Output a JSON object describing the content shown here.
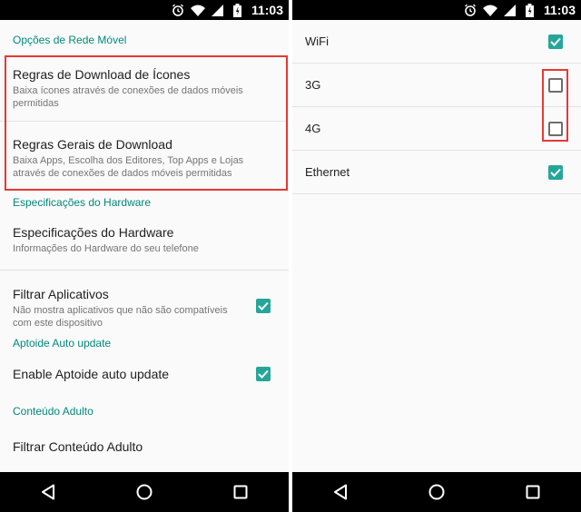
{
  "status": {
    "time": "11:03"
  },
  "left": {
    "sections": [
      {
        "header": "Opções de Rede Móvel"
      },
      {
        "header": "Especificações do Hardware"
      },
      {
        "header": "Aptoide Auto update"
      },
      {
        "header": "Conteúdo Adulto"
      }
    ],
    "items": {
      "download_icons": {
        "title": "Regras de Download de Ícones",
        "summary": "Baixa ícones através de conexões de dados móveis permitidas"
      },
      "download_general": {
        "title": "Regras Gerais de Download",
        "summary": "Baixa Apps, Escolha dos Editores, Top Apps e Lojas através de conexões de dados móveis permitidas"
      },
      "hardware_specs": {
        "title": "Especificações do Hardware",
        "summary": "Informações do Hardware do seu telefone"
      },
      "filter_apps": {
        "title": "Filtrar Aplicativos",
        "summary": "Não mostra aplicativos que não são compatíveis com este dispositivo",
        "checked": true
      },
      "auto_update": {
        "title": "Enable Aptoide auto update",
        "checked": true
      },
      "adult_filter": {
        "title": "Filtrar Conteúdo Adulto"
      }
    }
  },
  "right": {
    "options": [
      {
        "label": "WiFi",
        "checked": true
      },
      {
        "label": "3G",
        "checked": false
      },
      {
        "label": "4G",
        "checked": false
      },
      {
        "label": "Ethernet",
        "checked": true
      }
    ]
  },
  "colors": {
    "accent": "#26a69a",
    "section_header": "#00897b",
    "highlight": "#e53935"
  },
  "icons": [
    "alarm-icon",
    "wifi-icon",
    "signal-icon",
    "battery-icon",
    "back-icon",
    "home-icon",
    "recents-icon",
    "check-icon"
  ]
}
